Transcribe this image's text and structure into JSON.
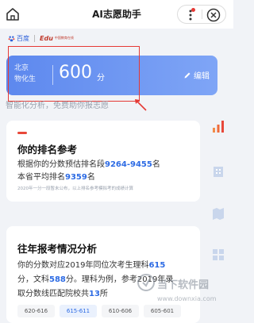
{
  "header": {
    "title": "AI志愿助手"
  },
  "partners": {
    "baidu": "百度",
    "edu_mark": "Edu",
    "edu_name": "中国教育在线"
  },
  "score_card": {
    "province": "北京",
    "category": "物化生",
    "score": "600",
    "unit": "分",
    "edit_label": "编辑"
  },
  "slogan": "智能化分析，免费助你报志愿",
  "rank_card": {
    "title": "你的排名参考",
    "line1_prefix": "根据你的分数预估排名段",
    "rank_range": "9264-9455",
    "line1_suffix": "名",
    "line2_prefix": "本省平均排名",
    "avg_rank": "9359",
    "line2_suffix": "名",
    "note": "2020年一分一段暂未公布，以上排名参考模拟考的成绩计算"
  },
  "history_card": {
    "title": "往年报考情况分析",
    "line1_prefix": "你的分数对应2019年同位次考生理科",
    "science_score": "615",
    "line2_unit": "分",
    "line2_mid": "，文科",
    "arts_score": "588",
    "line2_suffix": "分。理科为例，参考2019年录",
    "line3_prefix": "取分数线匹配院校共",
    "school_count": "13",
    "line3_suffix": "所",
    "chips": [
      "620-616",
      "615-611",
      "610-606",
      "605-601"
    ],
    "active_chip": "615-611"
  },
  "watermark": {
    "brand": "当下软件园",
    "url": "www.downxia.com"
  },
  "colors": {
    "accent_blue": "#2d6be4",
    "card_gradient_start": "#5d88ee",
    "card_gradient_end": "#7fa5f6",
    "annotation_red": "#e53935"
  }
}
